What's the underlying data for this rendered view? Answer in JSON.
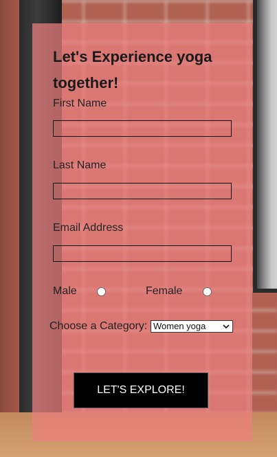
{
  "form": {
    "title": "Let's Experience yoga together!",
    "first_name_label": "First Name",
    "first_name_value": "",
    "last_name_label": "Last Name",
    "last_name_value": "",
    "email_label": "Email Address",
    "email_value": "",
    "gender": {
      "male_label": "Male",
      "female_label": "Female",
      "selected": null
    },
    "category_label": "Choose a Category:",
    "category_selected": "Women yoga",
    "submit_label": "LET'S EXPLORE!"
  },
  "icons": {
    "select_chevron": "chevron-down-icon"
  },
  "colors": {
    "panel_overlay": "#ec8080",
    "button_background": "#000000",
    "button_text": "#ffffff"
  }
}
